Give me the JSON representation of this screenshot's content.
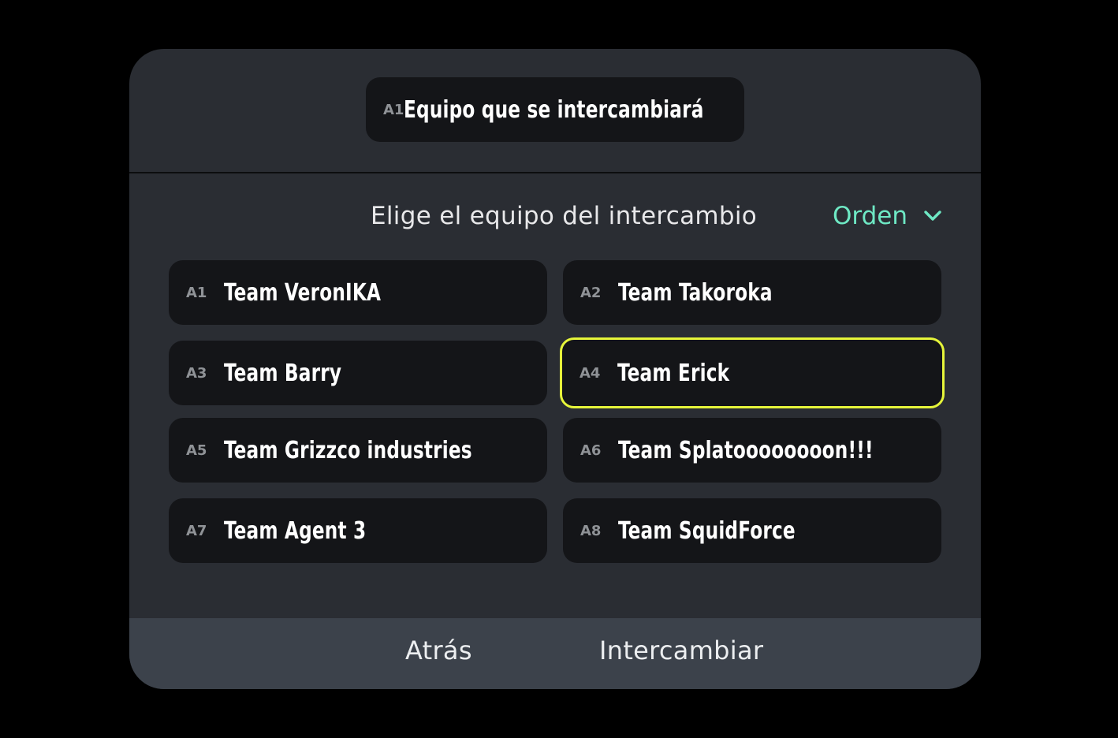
{
  "current": {
    "slot": "A1",
    "title": "Equipo que se intercambiará"
  },
  "section": {
    "title": "Elige el equipo del intercambio",
    "sort_label": "Orden",
    "sort_icon": "chevron-down-icon"
  },
  "teams": [
    {
      "slot": "A1",
      "name": "Team VeronIKA",
      "selected": false
    },
    {
      "slot": "A2",
      "name": "Team Takoroka",
      "selected": false
    },
    {
      "slot": "A3",
      "name": "Team Barry",
      "selected": false
    },
    {
      "slot": "A4",
      "name": "Team Erick",
      "selected": true
    },
    {
      "slot": "A5",
      "name": "Team Grizzco industries",
      "selected": false
    },
    {
      "slot": "A6",
      "name": "Team Splatoooooooon!!!",
      "selected": false
    },
    {
      "slot": "A7",
      "name": "Team Agent 3",
      "selected": false
    },
    {
      "slot": "A8",
      "name": "Team SquidForce",
      "selected": false
    }
  ],
  "footer": {
    "back_label": "Atrás",
    "swap_label": "Intercambiar"
  },
  "colors": {
    "accent": "#6ee8c4",
    "selection": "#e6f53a",
    "card": "#141518",
    "dialog": "#2a2d33",
    "footer": "#3c424b"
  }
}
